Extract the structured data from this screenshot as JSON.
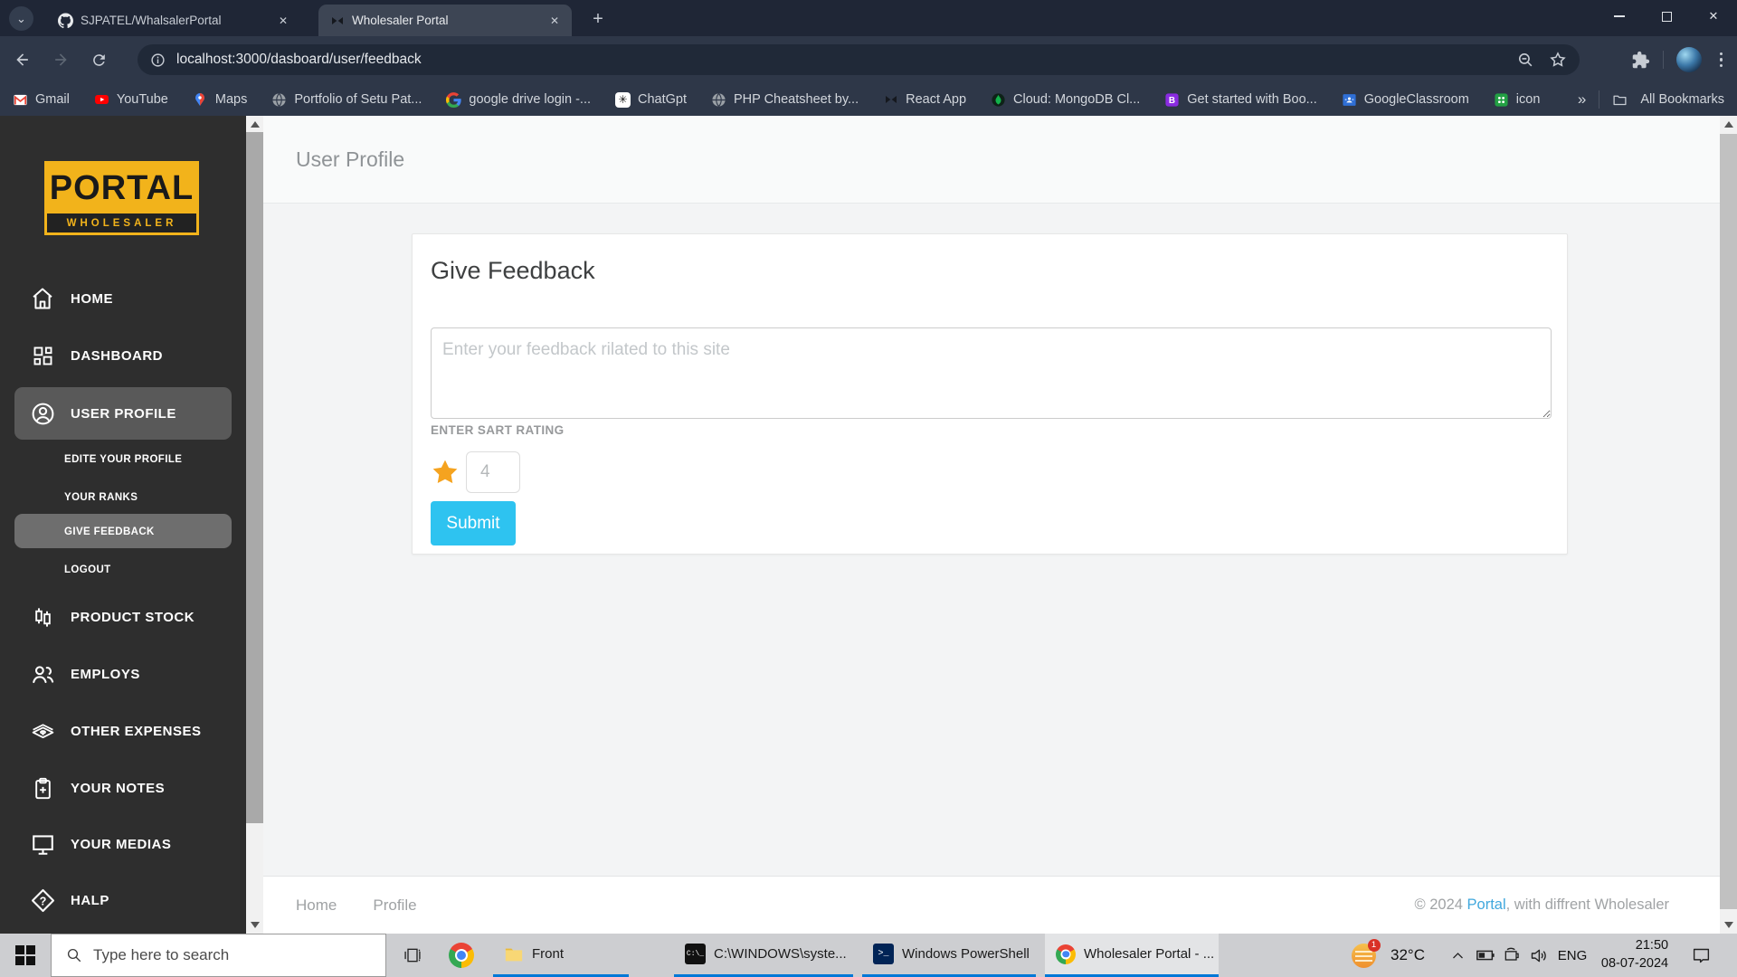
{
  "browser": {
    "tabs": [
      {
        "title": "SJPATEL/WhalsalerPortal"
      },
      {
        "title": "Wholesaler Portal"
      }
    ],
    "url": "localhost:3000/dasboard/user/feedback",
    "bookmarks": [
      "Gmail",
      "YouTube",
      "Maps",
      "Portfolio of Setu Pat...",
      "google drive login -...",
      "ChatGpt",
      "PHP Cheatsheet by...",
      "React App",
      "Cloud: MongoDB Cl...",
      "Get started with Boo...",
      "GoogleClassroom",
      "icon"
    ],
    "bookmarks_overflow": "»",
    "all_bookmarks": "All Bookmarks",
    "close_glyph": "✕",
    "new_tab_glyph": "+",
    "tab_search_glyph": "⌄"
  },
  "sidebar": {
    "logo_title": "PORTAL",
    "logo_subtitle": "WHOLESALER",
    "items": [
      "HOME",
      "DASHBOARD",
      "USER PROFILE",
      "PRODUCT STOCK",
      "EMPLOYS",
      "OTHER EXPENSES",
      "YOUR NOTES",
      "YOUR MEDIAS",
      "HALP"
    ],
    "submenu": [
      "EDITE YOUR PROFILE",
      "YOUR RANKS",
      "GIVE FEEDBACK",
      "LOGOUT"
    ]
  },
  "main": {
    "page_title": "User Profile",
    "card": {
      "title": "Give Feedback",
      "textarea_placeholder": "Enter your feedback rilated to this site",
      "rating_label": "ENTER SART RATING",
      "rating_value": "4",
      "submit_label": "Submit"
    },
    "footer": {
      "links": [
        "Home",
        "Profile"
      ],
      "copyright_prefix": "© 2024 ",
      "brand": "Portal",
      "copyright_suffix": ", with diffrent Wholesaler"
    }
  },
  "taskbar": {
    "search_placeholder": "Type here to search",
    "tasks": [
      "Front",
      "C:\\WINDOWS\\syste...",
      "Windows PowerShell",
      "Wholesaler Portal - ..."
    ],
    "tray": {
      "temperature": "32°C",
      "language": "ENG",
      "time": "21:50",
      "date": "08-07-2024"
    }
  },
  "colors": {
    "accent_cyan": "#2EC3F0",
    "star_orange": "#F5A31F",
    "logo_yellow": "#F2B31B",
    "link_blue": "#41A8DD",
    "task_underline_blue": "#0078D7"
  }
}
